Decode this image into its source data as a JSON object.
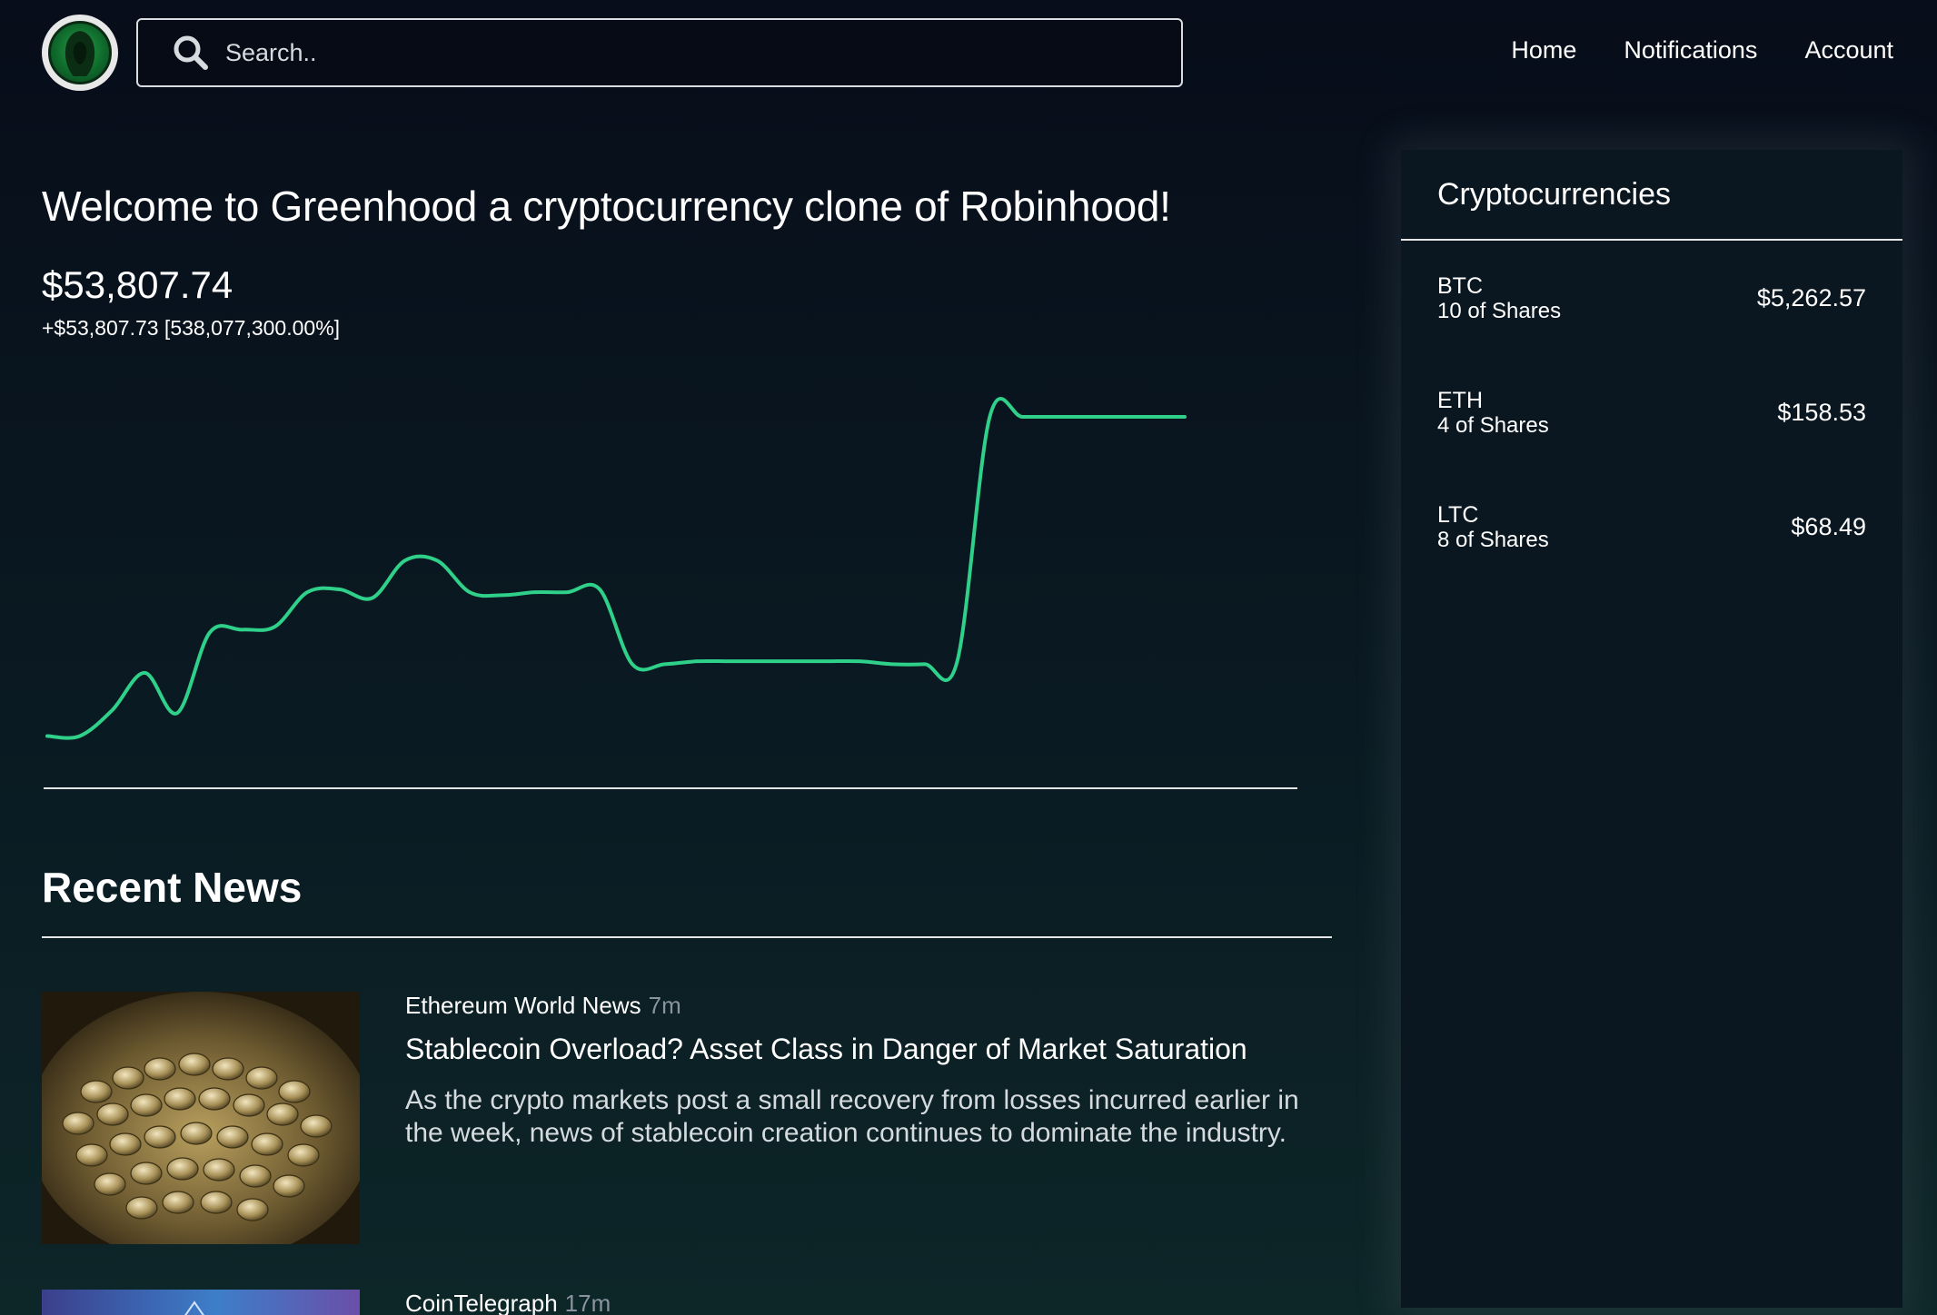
{
  "header": {
    "search_placeholder": "Search..",
    "nav": [
      {
        "label": "Home"
      },
      {
        "label": "Notifications"
      },
      {
        "label": "Account"
      }
    ]
  },
  "main": {
    "welcome": "Welcome to Greenhood a cryptocurrency clone of Robinhood!",
    "balance": "$53,807.74",
    "change": "+$53,807.73 [538,077,300.00%]"
  },
  "chart_data": {
    "type": "line",
    "title": "",
    "xlabel": "",
    "ylabel": "",
    "color": "#2fd08a",
    "x": [
      0,
      1,
      2,
      3,
      4,
      5,
      6,
      7,
      8,
      9,
      10,
      11,
      12,
      13,
      14,
      15,
      16,
      17,
      18,
      19,
      20,
      21,
      22,
      23,
      24,
      25,
      26,
      27,
      28,
      29,
      30,
      31,
      32,
      33,
      34,
      35
    ],
    "values": [
      3,
      3,
      12,
      25,
      11,
      39,
      40,
      41,
      53,
      54,
      51,
      64,
      64,
      53,
      52,
      53,
      53,
      54,
      28,
      28,
      29,
      29,
      29,
      29,
      29,
      29,
      28,
      28,
      29,
      114,
      114,
      114,
      114,
      114,
      114,
      114
    ],
    "ylim": [
      0,
      120
    ],
    "grid": false,
    "legend": "none"
  },
  "news": {
    "title": "Recent News",
    "items": [
      {
        "source": "Ethereum World News",
        "ago": "7m",
        "headline": "Stablecoin Overload? Asset Class in Danger of Market Saturation",
        "description": "As the crypto markets post a small recovery from losses incurred earlier in the week, news of stablecoin creation continues to dominate the industry."
      },
      {
        "source": "CoinTelegraph",
        "ago": "17m",
        "headline": "",
        "description": ""
      }
    ]
  },
  "sidebar": {
    "title": "Cryptocurrencies",
    "items": [
      {
        "symbol": "BTC",
        "shares": "10 of Shares",
        "price": "$5,262.57"
      },
      {
        "symbol": "ETH",
        "shares": "4 of Shares",
        "price": "$158.53"
      },
      {
        "symbol": "LTC",
        "shares": "8 of Shares",
        "price": "$68.49"
      }
    ]
  },
  "icons": {
    "logo": "hooded-figure-logo-icon",
    "search": "search-icon"
  }
}
